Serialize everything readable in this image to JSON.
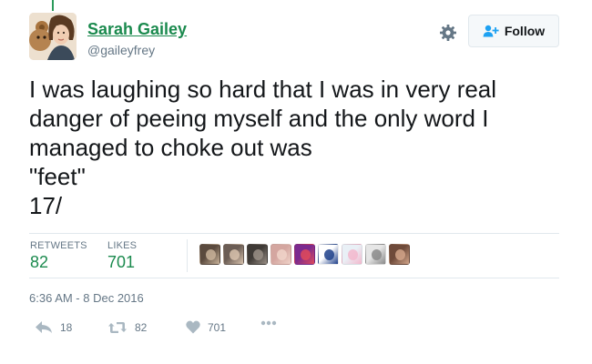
{
  "colors": {
    "name_link": "#1b8a4e",
    "stat_value": "#1b8a4e",
    "muted": "#657786",
    "divider": "#e1e8ed",
    "text": "#14171a"
  },
  "author": {
    "display_name": "Sarah Gailey",
    "handle": "@gaileyfrey",
    "avatar_icon": "avatar-woman-with-teddy-bear"
  },
  "header": {
    "settings_icon": "gear-icon",
    "follow_label": "Follow",
    "follow_icon": "add-user-icon"
  },
  "tweet": {
    "lines": [
      "I was laughing so hard that I was in very real",
      "danger of peeing myself and the only word I",
      "managed to choke out was",
      "\"feet\"",
      "17/"
    ]
  },
  "stats": {
    "retweets_label": "RETWEETS",
    "retweets_count": "82",
    "likes_label": "LIKES",
    "likes_count": "701"
  },
  "likers": [
    {
      "name": "liker-avatar-1",
      "colors": [
        "#5a4a3e",
        "#c9b39a"
      ]
    },
    {
      "name": "liker-avatar-2",
      "colors": [
        "#6b5d55",
        "#d8c2ad"
      ]
    },
    {
      "name": "liker-avatar-3",
      "colors": [
        "#3f3a36",
        "#9a8f86"
      ]
    },
    {
      "name": "liker-avatar-4",
      "colors": [
        "#d4a6a0",
        "#f0d3c9"
      ]
    },
    {
      "name": "liker-avatar-5",
      "colors": [
        "#7b2a8f",
        "#e04a5a"
      ]
    },
    {
      "name": "liker-avatar-6",
      "colors": [
        "#ffffff",
        "#1d3f8a"
      ]
    },
    {
      "name": "liker-avatar-7",
      "colors": [
        "#e9f0f6",
        "#f3b7cc"
      ]
    },
    {
      "name": "liker-avatar-8",
      "colors": [
        "#e6e6e6",
        "#8a8a8a"
      ]
    },
    {
      "name": "liker-avatar-9",
      "colors": [
        "#6e4a3a",
        "#d2a58a"
      ]
    }
  ],
  "timestamp": "6:36 AM - 8 Dec 2016",
  "actions": {
    "reply_icon": "reply-icon",
    "reply_count": "18",
    "retweet_icon": "retweet-icon",
    "retweet_count": "82",
    "like_icon": "heart-icon",
    "like_count": "701",
    "more_icon": "more-dots-icon"
  }
}
